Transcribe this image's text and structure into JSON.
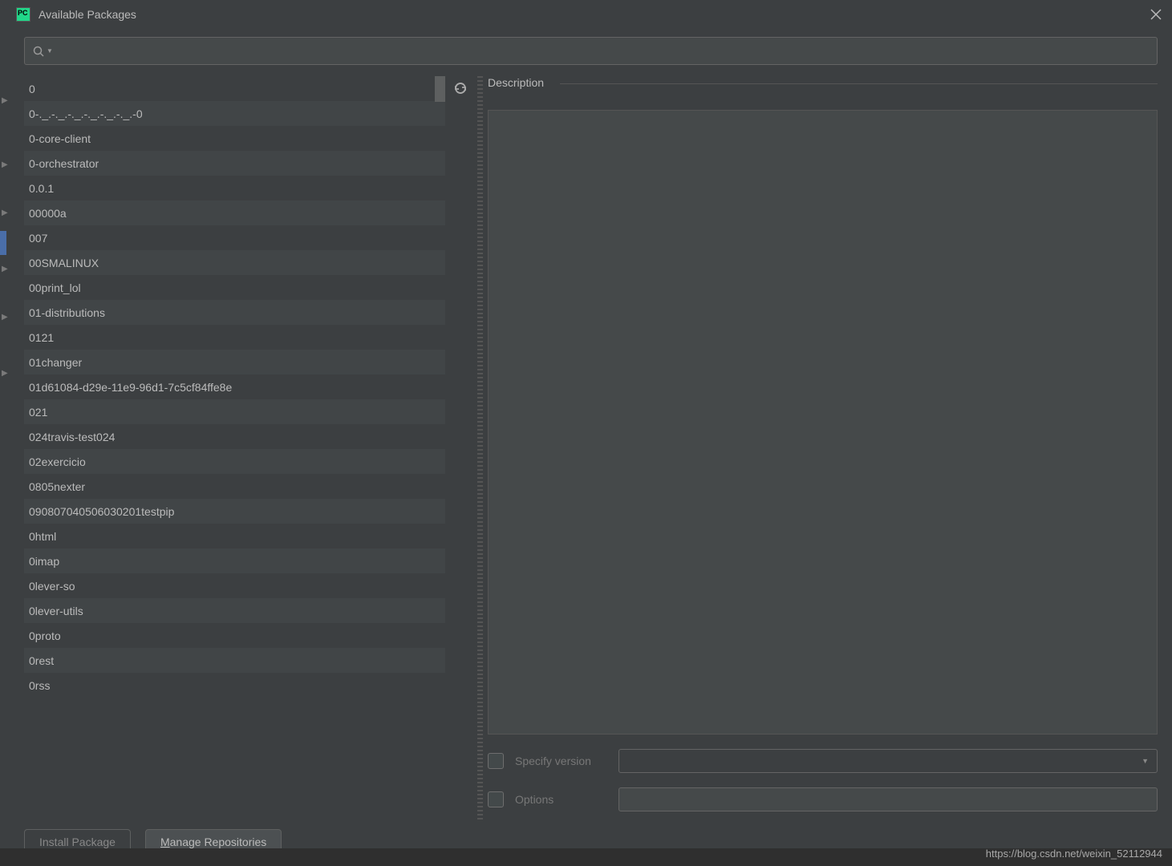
{
  "title": "Available Packages",
  "search": {
    "placeholder": ""
  },
  "packages": [
    "0",
    "0-._.-._.-._.-._.-._.-._.-0",
    "0-core-client",
    "0-orchestrator",
    "0.0.1",
    "00000a",
    "007",
    "00SMALINUX",
    "00print_lol",
    "01-distributions",
    "0121",
    "01changer",
    "01d61084-d29e-11e9-96d1-7c5cf84ffe8e",
    "021",
    "024travis-test024",
    "02exercicio",
    "0805nexter",
    "090807040506030201testpip",
    "0html",
    "0imap",
    "0lever-so",
    "0lever-utils",
    "0proto",
    "0rest",
    "0rss"
  ],
  "description_label": "Description",
  "options": {
    "specify_version": "Specify version",
    "options_label": "Options"
  },
  "buttons": {
    "install": "Install Package",
    "manage_first": "M",
    "manage_rest": "anage Repositories"
  },
  "watermark": "https://blog.csdn.net/weixin_52112944"
}
